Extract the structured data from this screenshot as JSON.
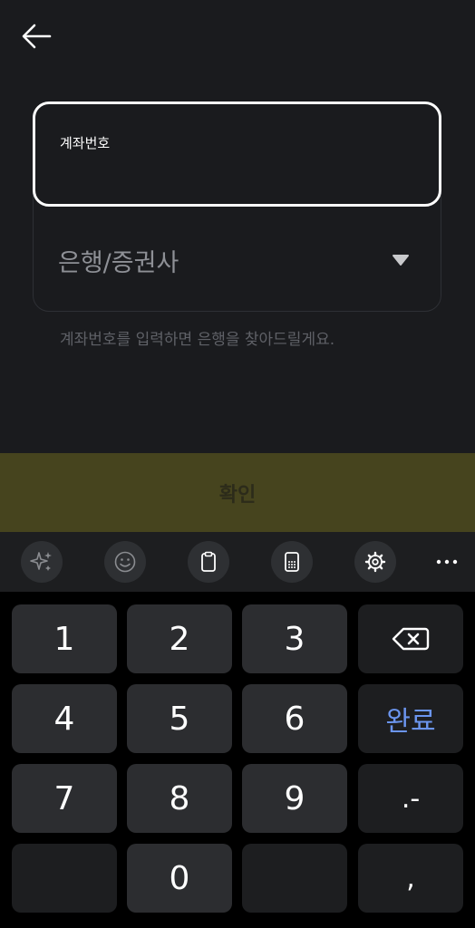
{
  "header": {
    "back_icon": "arrow-left-icon"
  },
  "form": {
    "account_label": "계좌번호",
    "bank_placeholder": "은행/증권사",
    "bank_dropdown_icon": "triangle-down-icon",
    "helper_text": "계좌번호를 입력하면 은행을 찾아드릴게요."
  },
  "confirm": {
    "label": "확인"
  },
  "keyboard": {
    "toolbar": [
      {
        "name": "ai-sparkle-icon"
      },
      {
        "name": "emoji-icon"
      },
      {
        "name": "clipboard-icon"
      },
      {
        "name": "keypad-mode-icon"
      },
      {
        "name": "settings-gear-icon"
      },
      {
        "name": "more-dots-icon"
      }
    ],
    "keys": {
      "k1": "1",
      "k2": "2",
      "k3": "3",
      "backspace_icon": "backspace-icon",
      "k4": "4",
      "k5": "5",
      "k6": "6",
      "done": "완료",
      "k7": "7",
      "k8": "8",
      "k9": "9",
      "dot_dash": ".-",
      "k0": "0",
      "comma": ","
    }
  },
  "colors": {
    "background": "#1a1b1e",
    "confirm_bg": "#46441e",
    "done_key_text": "#6b95ee",
    "key_bg": "#2c2d30",
    "keypad_bg": "#000000"
  }
}
